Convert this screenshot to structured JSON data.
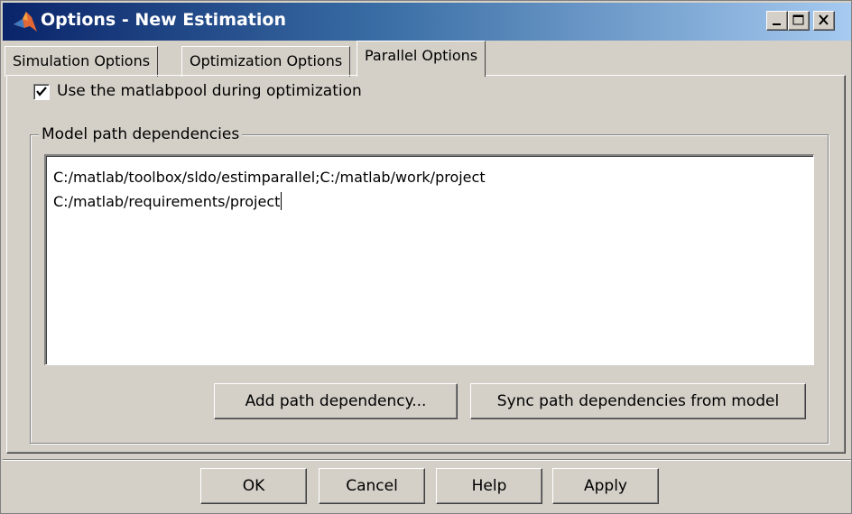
{
  "window": {
    "title": "Options - New Estimation",
    "icon": "matlab-logo-icon",
    "controls": [
      "minimize-icon",
      "maximize-icon",
      "close-icon"
    ]
  },
  "tabs": [
    {
      "label": "Simulation Options",
      "active": false
    },
    {
      "label": "Optimization Options",
      "active": false
    },
    {
      "label": "Parallel Options",
      "active": true
    }
  ],
  "parallel": {
    "use_matlabpool_label": "Use the matlabpool during optimization",
    "use_matlabpool_checked": true,
    "group_title": "Model path dependencies",
    "paths": [
      "C:/matlab/toolbox/sldo/estimparallel;C:/matlab/work/project",
      "C:/matlab/requirements/project"
    ],
    "add_button": "Add path dependency...",
    "sync_button": "Sync path dependencies from model"
  },
  "footer": {
    "ok": "OK",
    "cancel": "Cancel",
    "help": "Help",
    "apply": "Apply"
  }
}
